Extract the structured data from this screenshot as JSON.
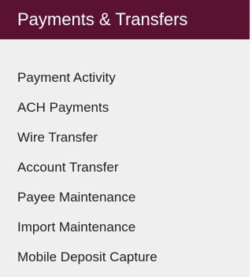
{
  "header": {
    "title": "Payments & Transfers"
  },
  "menu": {
    "items": [
      {
        "label": "Payment Activity"
      },
      {
        "label": "ACH Payments"
      },
      {
        "label": "Wire Transfer"
      },
      {
        "label": "Account Transfer"
      },
      {
        "label": "Payee Maintenance"
      },
      {
        "label": "Import Maintenance"
      },
      {
        "label": "Mobile Deposit Capture"
      }
    ]
  },
  "colors": {
    "header_background": "#5a1230",
    "header_text": "#ffffff",
    "panel_background": "#efefef",
    "item_text": "#1f1f1f"
  }
}
